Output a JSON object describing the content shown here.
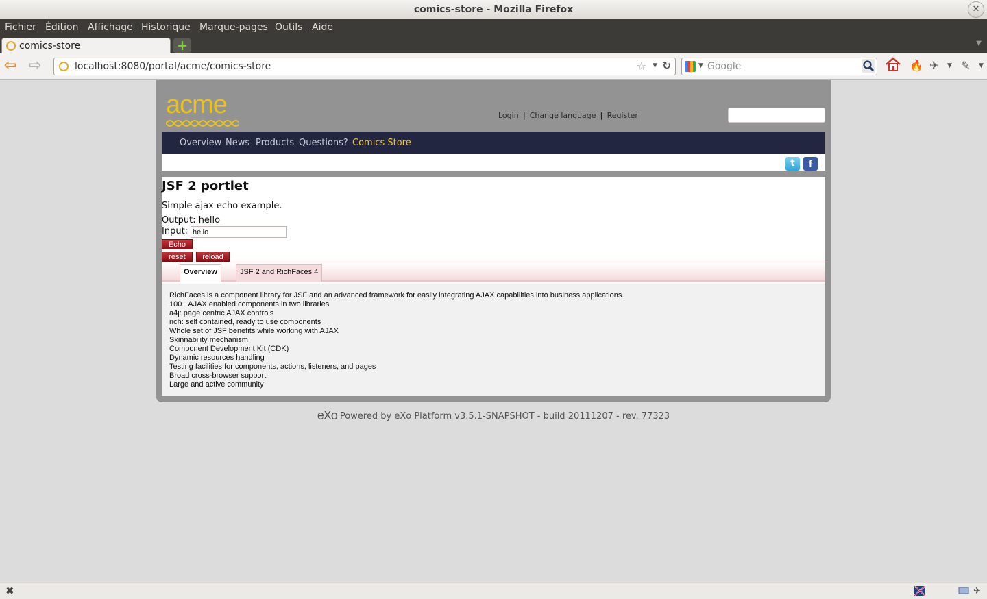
{
  "window": {
    "title": "comics-store - Mozilla Firefox",
    "close_glyph": "✕"
  },
  "menu": [
    "Fichier",
    "Édition",
    "Affichage",
    "Historique",
    "Marque-pages",
    "Outils",
    "Aide"
  ],
  "tab": {
    "title": "comics-store",
    "new_tab_glyph": "+"
  },
  "nav": {
    "url": "localhost:8080/portal/acme/comics-store",
    "search_placeholder": "Google"
  },
  "site": {
    "logo": "acme",
    "top_links": [
      "Login",
      "Change language",
      "Register"
    ],
    "nav_items": [
      "Overview",
      "News",
      "Products",
      "Questions?",
      "Comics Store"
    ],
    "active_nav": "Comics Store",
    "social": {
      "twitter": "t",
      "facebook": "f"
    }
  },
  "portlet": {
    "title": "JSF 2 portlet",
    "description": "Simple ajax echo example.",
    "output_label": "Output:",
    "output_value": "hello",
    "input_label": "Input:",
    "input_value": "hello",
    "buttons": {
      "echo": "Echo",
      "reset": "reset",
      "reload": "reload"
    },
    "tabs": [
      "Overview",
      "JSF 2 and RichFaces 4"
    ],
    "content_lines": [
      "RichFaces is a component library for JSF and an advanced framework for easily integrating AJAX capabilities into business applications.",
      "100+ AJAX enabled components in two libraries",
      "a4j: page centric AJAX controls",
      "rich: self contained, ready to use components",
      "Whole set of JSF benefits while working with AJAX",
      "Skinnability mechanism",
      "Component Development Kit (CDK)",
      "Dynamic resources handling",
      "Testing facilities for components, actions, listeners, and pages",
      "Broad cross-browser support",
      "Large and active community"
    ]
  },
  "footer": {
    "logo": "eXo",
    "text": "Powered by eXo Platform v3.5.1-SNAPSHOT - build 20111207 - rev. 77323"
  },
  "colors": {
    "nav_bg": "#232640",
    "accent_yellow": "#f3c72a",
    "button_red": "#a5161c"
  }
}
